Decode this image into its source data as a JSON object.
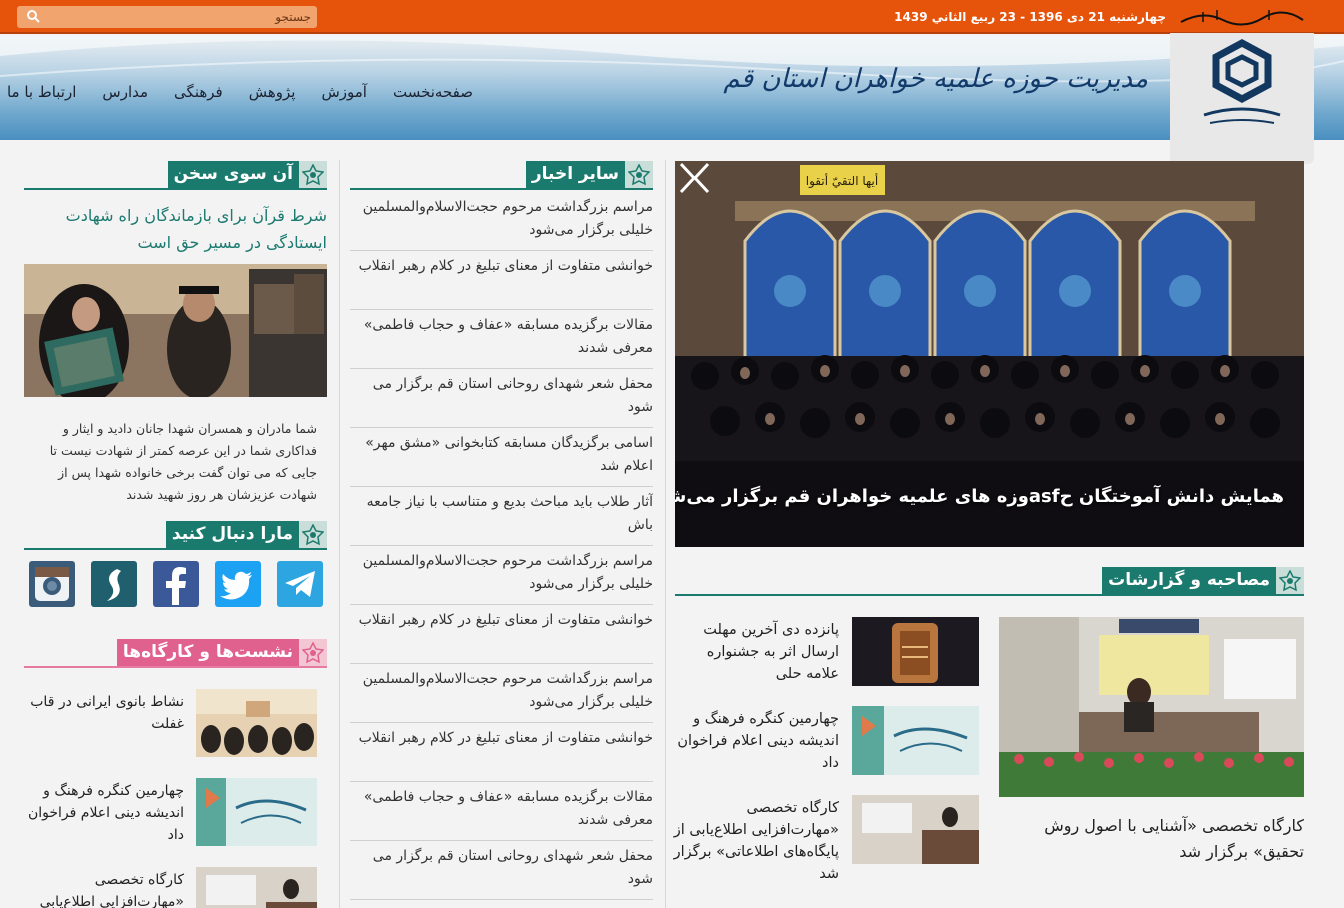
{
  "topbar": {
    "search_placeholder": "جستجو",
    "date": "چهارشنبه 21 دی 1396 - 23 ربيع الثاني 1439"
  },
  "header": {
    "site_title": "مدیریت حوزه علمیه خواهران استان قم",
    "nav": [
      "صفحه‌نخست",
      "آموزش",
      "پژوهش",
      "فرهنگی",
      "مدارس",
      "ارتباط با ما"
    ]
  },
  "slider": {
    "caption": "همایش دانش آموختگان حasfوزه های علمیه خواهران قم برگزار می‌شود",
    "banner_text": "أيها التقيّ أتقوا"
  },
  "sections": {
    "other_news": "سایر اخبار",
    "editorial": "آن سوی سخن",
    "follow_us": "مارا دنبال کنید",
    "workshops": "نشست‌ها و کارگاه‌ها",
    "interviews": "مصاحبه و گزارشات"
  },
  "other_news": [
    "مراسم بزرگداشت مرحوم حجت‌الاسلام‌والمسلمین خلیلی برگزار می‌شود",
    "خوانشی متفاوت از معنای تبلیغ در کلام رهبر انقلاب",
    "مقالات برگزیده مسابقه «عفاف و حجاب فاطمی» معرفی شدند",
    "محفل شعر شهدای روحانی استان قم برگزار می شود",
    "اسامی برگزیدگان مسابقه کتابخوانی «مشق مهر» اعلام شد",
    "آثار طلاب باید مباحث بدیع و متناسب با نیاز جامعه باش",
    "مراسم بزرگداشت مرحوم حجت‌الاسلام‌والمسلمین خلیلی برگزار می‌شود",
    "خوانشی متفاوت از معنای تبلیغ در کلام رهبر انقلاب",
    "مراسم بزرگداشت مرحوم حجت‌الاسلام‌والمسلمین خلیلی برگزار می‌شود",
    "خوانشی متفاوت از معنای تبلیغ در کلام رهبر انقلاب",
    "مقالات برگزیده مسابقه «عفاف و حجاب فاطمی» معرفی شدند",
    "محفل شعر شهدای روحانی استان قم برگزار می شود"
  ],
  "editorial": {
    "title": "شرط قرآن برای بازماندگان راه شهادت ایستادگی در مسیر حق است",
    "description": "شما مادران و همسران شهدا جانان دادید و ایثار و فداکاری شما در این عرصه کمتر از شهادت نیست تا جایی که می توان گفت برخی خانواده شهدا پس از شهادت عزیزشان هر روز شهید شدند"
  },
  "social_icons": [
    "instagram-icon",
    "soroush-icon",
    "facebook-icon",
    "twitter-icon",
    "telegram-icon"
  ],
  "workshops": [
    "نشاط بانوی ایرانی در قاب غفلت",
    "چهارمین کنگره فرهنگ و اندیشه دینی اعلام فراخوان داد",
    "کارگاه تخصصی «مهارت‌افزایی اطلاع‌یابی"
  ],
  "interviews": {
    "featured": "کارگاه تخصصی «آشنایی با اصول روش تحقیق» برگزار شد",
    "items": [
      "پانزده دی آخرین مهلت ارسال اثر به جشنواره علامه حلی",
      "چهارمین کنگره فرهنگ و اندیشه دینی اعلام فراخوان داد",
      "کارگاه تخصصی «مهارت‌افزایی اطلاع‌یابی از پایگاه‌های اطلاعاتی» برگزار شد"
    ]
  },
  "colors": {
    "topbar": "#e6540c",
    "teal": "#1b7a6e",
    "pink": "#e0608e"
  }
}
